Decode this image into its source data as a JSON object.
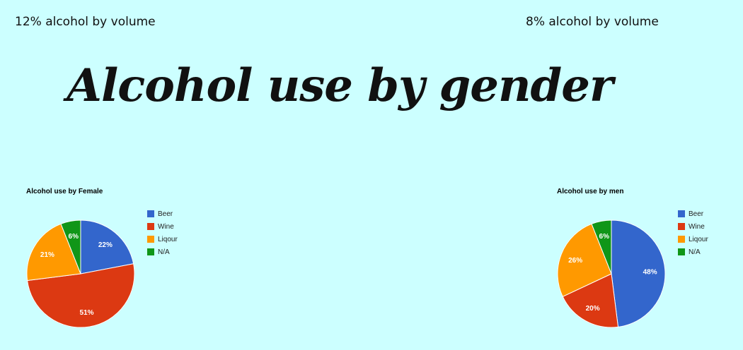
{
  "header": {
    "left_note": "12% alcohol by volume",
    "right_note": "8% alcohol by volume",
    "title": "Alcohol use by gender"
  },
  "colors": {
    "background": "#ccffff",
    "Beer": "#3366cc",
    "Wine": "#dc3912",
    "Liqour": "#ff9900",
    "N/A": "#109618"
  },
  "chart_data": [
    {
      "type": "pie",
      "title": "Alcohol use by Female",
      "legend_position": "right",
      "categories": [
        "Beer",
        "Wine",
        "Liqour",
        "N/A"
      ],
      "values": [
        22,
        51,
        21,
        6
      ],
      "labels": [
        "22%",
        "51%",
        "21%",
        "6%"
      ]
    },
    {
      "type": "pie",
      "title": "Alcohol use by men",
      "legend_position": "right",
      "categories": [
        "Beer",
        "Wine",
        "Liqour",
        "N/A"
      ],
      "values": [
        48,
        20,
        26,
        6
      ],
      "labels": [
        "48%",
        "20%",
        "26%",
        "6%"
      ]
    }
  ]
}
